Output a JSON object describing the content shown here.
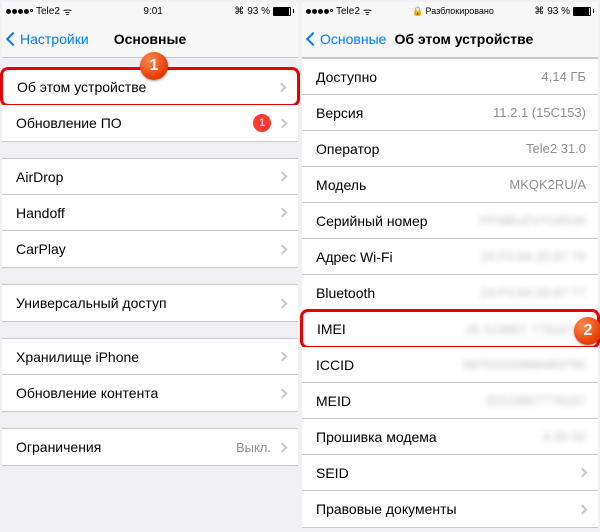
{
  "left": {
    "status": {
      "carrier": "Tele2",
      "wifi": "⚲",
      "time": "9:01",
      "bt": "✱",
      "pct": "93 %"
    },
    "nav": {
      "back": "Настройки",
      "title": "Основные"
    },
    "callout": "1",
    "groups": [
      {
        "rows": [
          {
            "label": "Об этом устройстве",
            "chevron": true,
            "highlight": true
          },
          {
            "label": "Обновление ПО",
            "badge": "1",
            "chevron": true
          }
        ]
      },
      {
        "rows": [
          {
            "label": "AirDrop",
            "chevron": true
          },
          {
            "label": "Handoff",
            "chevron": true
          },
          {
            "label": "CarPlay",
            "chevron": true
          }
        ]
      },
      {
        "rows": [
          {
            "label": "Универсальный доступ",
            "chevron": true
          }
        ]
      },
      {
        "rows": [
          {
            "label": "Хранилище iPhone",
            "chevron": true
          },
          {
            "label": "Обновление контента",
            "chevron": true
          }
        ]
      },
      {
        "rows": [
          {
            "label": "Ограничения",
            "value": "Выкл.",
            "chevron": true
          }
        ]
      }
    ]
  },
  "right": {
    "status": {
      "carrier": "Tele2",
      "unlocked": "Разблокировано",
      "bt": "✱",
      "pct": "93 %"
    },
    "nav": {
      "back": "Основные",
      "title": "Об этом устройстве"
    },
    "callout": "2",
    "rows": [
      {
        "label": "Доступно",
        "value": "4,14 ГБ"
      },
      {
        "label": "Версия",
        "value": "11.2.1 (15C153)"
      },
      {
        "label": "Оператор",
        "value": "Tele2 31.0"
      },
      {
        "label": "Модель",
        "value": "MKQK2RU/A"
      },
      {
        "label": "Серийный номер",
        "value": "FFNBUZVYGRHA",
        "blur": true
      },
      {
        "label": "Адрес Wi-Fi",
        "value": "24:F0:94:20:87:76",
        "blur": true
      },
      {
        "label": "Bluetooth",
        "value": "24:F0:94:20:87:77",
        "blur": true
      },
      {
        "label": "IMEI",
        "value": "35 519807 779167 9",
        "blur": true,
        "highlight": true
      },
      {
        "label": "ICCID",
        "value": "89701020968483795",
        "blur": true
      },
      {
        "label": "MEID",
        "value": "35519807779167",
        "blur": true
      },
      {
        "label": "Прошивка модема",
        "value": "4.30.02",
        "blur": true
      },
      {
        "label": "SEID",
        "value": "",
        "chevron": true
      },
      {
        "label": "Правовые документы",
        "value": "",
        "chevron": true
      }
    ]
  }
}
